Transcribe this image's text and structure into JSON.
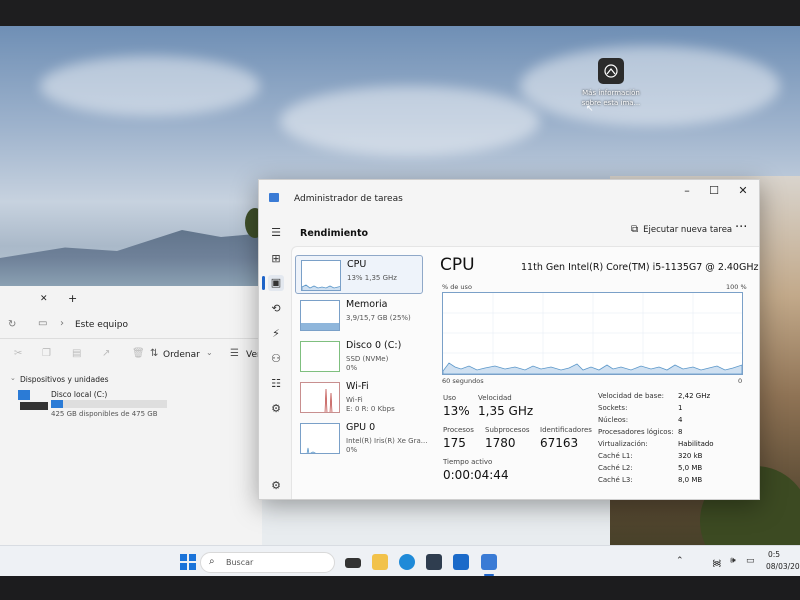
{
  "desktop": {
    "info_icon_label": "Más información sobre esta ima..."
  },
  "explorer": {
    "tab_close": "✕",
    "tab_add": "+",
    "location": "Este equipo",
    "sort_label": "Ordenar",
    "view_label": "Ver",
    "group_header": "Dispositivos y unidades",
    "drive_name": "Disco local (C:)",
    "drive_free": "425 GB disponibles de 475 GB",
    "drive_used_fraction": 0.105
  },
  "task_manager": {
    "title": "Administrador de tareas",
    "section": "Rendimiento",
    "run_new_task": "Ejecutar nueva tarea",
    "more": "···",
    "resources": [
      {
        "name": "CPU",
        "sub1": "13% 1,35 GHz",
        "sub2": ""
      },
      {
        "name": "Memoria",
        "sub1": "3,9/15,7 GB (25%)",
        "sub2": ""
      },
      {
        "name": "Disco 0 (C:)",
        "sub1": "SSD (NVMe)",
        "sub2": "0%"
      },
      {
        "name": "Wi-Fi",
        "sub1": "Wi-Fi",
        "sub2": "E: 0 R: 0 Kbps"
      },
      {
        "name": "GPU 0",
        "sub1": "Intel(R) Iris(R) Xe Gra...",
        "sub2": "0%"
      }
    ],
    "detail": {
      "title": "CPU",
      "model": "11th Gen Intel(R) Core(TM) i5-1135G7 @ 2.40GHz",
      "util_label": "% de uso",
      "util_max": "100 %",
      "time_label": "60 segundos",
      "time_end": "0",
      "utilization_label": "Uso",
      "utilization_value": "13%",
      "speed_label": "Velocidad",
      "speed_value": "1,35 GHz",
      "processes_label": "Procesos",
      "processes_value": "175",
      "threads_label": "Subprocesos",
      "threads_value": "1780",
      "handles_label": "Identificadores",
      "handles_value": "67163",
      "uptime_label": "Tiempo activo",
      "uptime_value": "0:00:04:44",
      "info": [
        {
          "label": "Velocidad de base:",
          "value": "2,42 GHz"
        },
        {
          "label": "Sockets:",
          "value": "1"
        },
        {
          "label": "Núcleos:",
          "value": "4"
        },
        {
          "label": "Procesadores lógicos:",
          "value": "8"
        },
        {
          "label": "Virtualización:",
          "value": "Habilitado"
        },
        {
          "label": "Caché L1:",
          "value": "320 kB"
        },
        {
          "label": "Caché L2:",
          "value": "5,0 MB"
        },
        {
          "label": "Caché L3:",
          "value": "8,0 MB"
        }
      ]
    }
  },
  "taskbar": {
    "search_placeholder": "Buscar",
    "clock_time": "0:5",
    "clock_date": "08/03/20"
  },
  "colors": {
    "accent": "#1e64c8",
    "graph_line": "#5b97c9",
    "graph_fill": "#cfe0f1",
    "memory_fill": "#8fb6db",
    "wifi_line": "#c0504d",
    "gpu_line": "#5b97c9"
  }
}
